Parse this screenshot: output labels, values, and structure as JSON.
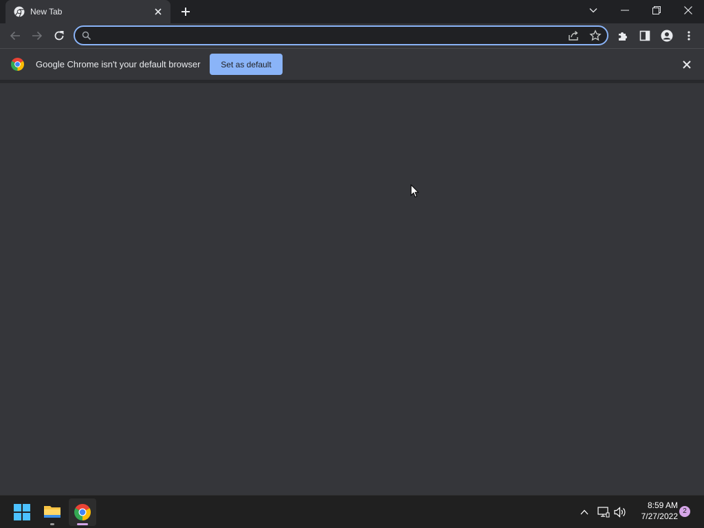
{
  "browser": {
    "tab": {
      "title": "New Tab"
    },
    "omnibox": {
      "value": "",
      "placeholder": ""
    }
  },
  "infobar": {
    "message": "Google Chrome isn't your default browser",
    "button_label": "Set as default"
  },
  "taskbar": {
    "clock": {
      "time": "8:59 AM",
      "date": "7/27/2022"
    },
    "notification_count": "2"
  },
  "colors": {
    "accent": "#8ab4f8",
    "frame": "#202124",
    "toolbar": "#35363a",
    "taskbar": "#202020"
  },
  "icons": {
    "tab": "chrome-icon",
    "infobar": "chrome-logo-icon",
    "taskbar": [
      "windows-start-icon",
      "file-explorer-icon",
      "chrome-icon"
    ],
    "tray": [
      "chevron-up-icon",
      "network-icon",
      "volume-icon"
    ]
  }
}
